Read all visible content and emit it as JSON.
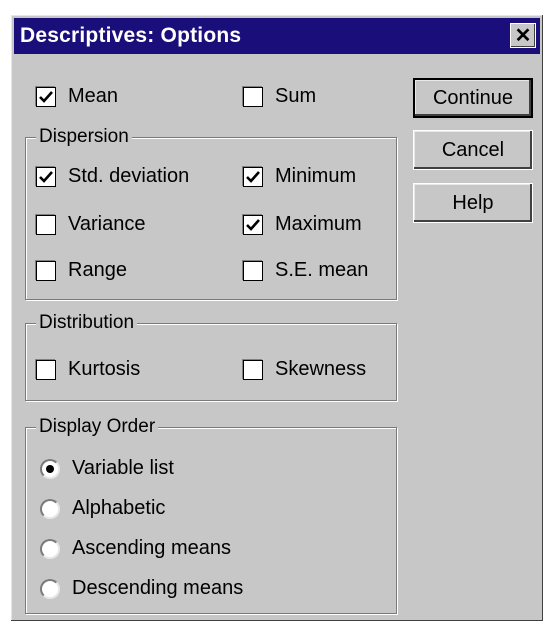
{
  "window": {
    "title": "Descriptives: Options",
    "close_glyph": "✕"
  },
  "top": {
    "mean": {
      "label": "Mean",
      "checked": true
    },
    "sum": {
      "label": "Sum",
      "checked": false
    }
  },
  "dispersion": {
    "legend": "Dispersion",
    "std_deviation": {
      "label": "Std. deviation",
      "checked": true
    },
    "minimum": {
      "label": "Minimum",
      "checked": true
    },
    "variance": {
      "label": "Variance",
      "checked": false
    },
    "maximum": {
      "label": "Maximum",
      "checked": true
    },
    "range": {
      "label": "Range",
      "checked": false
    },
    "se_mean": {
      "label": "S.E. mean",
      "checked": false
    }
  },
  "distribution": {
    "legend": "Distribution",
    "kurtosis": {
      "label": "Kurtosis",
      "checked": false
    },
    "skewness": {
      "label": "Skewness",
      "checked": false
    }
  },
  "display_order": {
    "legend": "Display Order",
    "options": [
      {
        "label": "Variable list",
        "selected": true
      },
      {
        "label": "Alphabetic",
        "selected": false
      },
      {
        "label": "Ascending means",
        "selected": false
      },
      {
        "label": "Descending means",
        "selected": false
      }
    ]
  },
  "buttons": {
    "continue": "Continue",
    "cancel": "Cancel",
    "help": "Help"
  },
  "colors": {
    "titlebar": "#1a0f7a",
    "face": "#c7c7c7"
  }
}
